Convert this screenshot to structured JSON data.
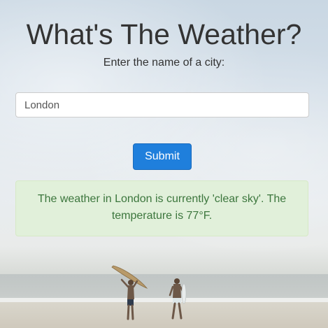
{
  "header": {
    "title": "What's The Weather?",
    "subtitle": "Enter the name of a city:"
  },
  "form": {
    "city_value": "London",
    "submit_label": "Submit"
  },
  "result": {
    "message": "The weather in London is currently 'clear sky'. The temperature is 77°F."
  },
  "colors": {
    "button": "#1f7fdc",
    "alert_background": "#dff0d8",
    "alert_text": "#3c763d",
    "title_text": "#333333"
  },
  "background": {
    "scene": "beach-with-surfers"
  }
}
